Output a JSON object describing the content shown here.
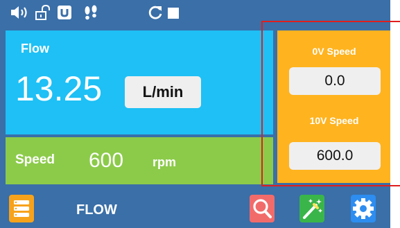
{
  "flow": {
    "title": "Flow",
    "value": "13.25",
    "unit": "L/min"
  },
  "speed": {
    "label": "Speed",
    "value": "600",
    "unit": "rpm"
  },
  "settings": {
    "zero_v_label": "0V Speed",
    "zero_v_value": "0.0",
    "ten_v_label": "10V Speed",
    "ten_v_value": "600.0"
  },
  "bottom_bar": {
    "mode_label": "FLOW"
  },
  "status_icons": [
    "speaker-icon",
    "unlock-icon",
    "u-badge-icon",
    "footprints-icon",
    "refresh-icon",
    "stop-icon"
  ],
  "bottom_icons": [
    "menu-list-icon",
    "search-icon",
    "magic-wand-icon",
    "gear-icon"
  ],
  "colors": {
    "background": "#3a6fa8",
    "flow_panel": "#1ec0f5",
    "speed_panel": "#8ccb4a",
    "settings_panel": "#ffb31f",
    "highlight_frame": "#e01e1e",
    "menu_button": "#f7a21b",
    "search_button": "#f26b6b",
    "wand_button": "#3ab54a",
    "gear_button": "#2d8df0"
  }
}
